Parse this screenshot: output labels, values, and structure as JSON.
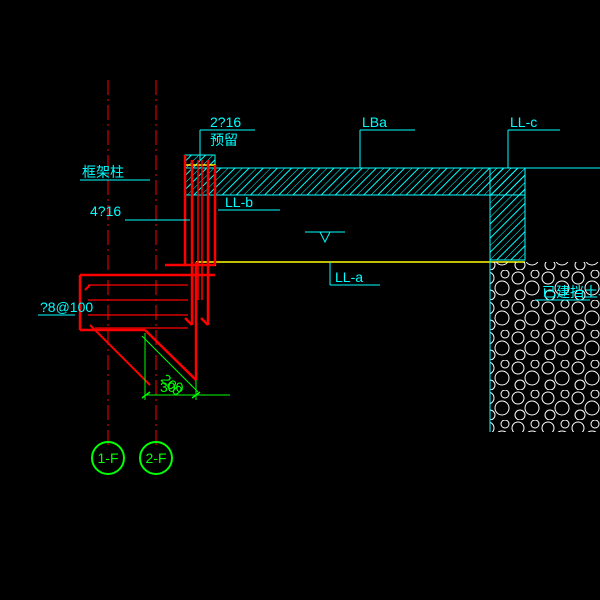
{
  "labels": {
    "beam_LBa": "LBa",
    "beam_LLc": "LL-c",
    "beam_LLb": "LL-b",
    "beam_LLa": "LL-a",
    "column_label": "框架柱",
    "wall_label": "已建挡土墙",
    "rebar_top": "2?16",
    "rebar_top_note": "预留",
    "rebar_side": "4?16",
    "rebar_stirrup": "?8@100"
  },
  "dimensions": {
    "dim_200": "200",
    "dim_300": "300"
  },
  "grids": {
    "grid_1F": "1-F",
    "grid_2F": "2-F"
  }
}
